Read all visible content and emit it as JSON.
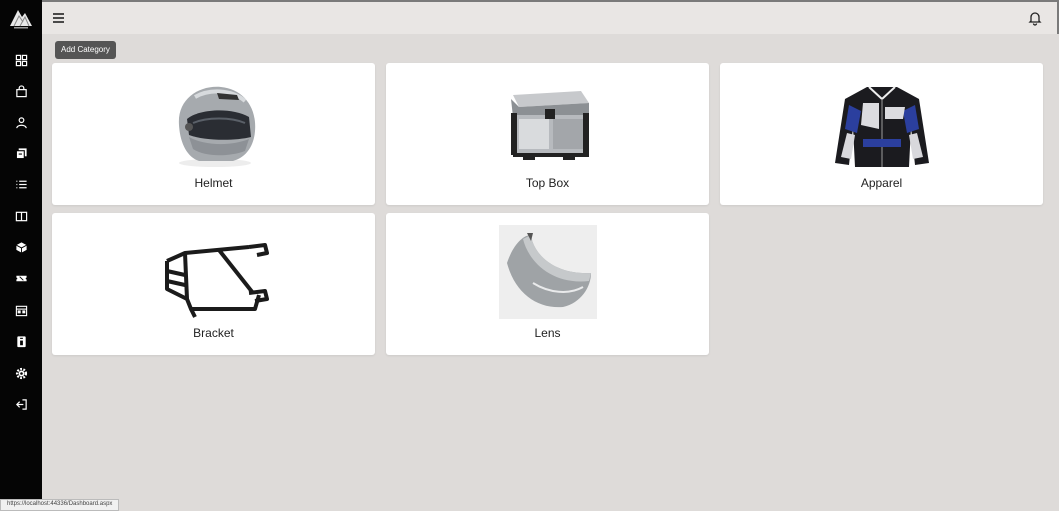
{
  "sidebar": {
    "logo": "mountain-logo-icon",
    "items": [
      {
        "icon": "dashboard-grid-icon"
      },
      {
        "icon": "shopping-bag-icon"
      },
      {
        "icon": "user-icon"
      },
      {
        "icon": "copy-stack-icon"
      },
      {
        "icon": "list-icon"
      },
      {
        "icon": "book-open-icon"
      },
      {
        "icon": "cube-icon"
      },
      {
        "icon": "ticket-icon"
      },
      {
        "icon": "calendar-icon"
      },
      {
        "icon": "id-badge-icon"
      },
      {
        "icon": "settings-icon"
      },
      {
        "icon": "logout-icon"
      }
    ]
  },
  "topbar": {
    "menu_icon": "hamburger-menu-icon",
    "notification_icon": "bell-icon"
  },
  "toolbar": {
    "add_label": "Add Category"
  },
  "categories": [
    {
      "label": "Helmet"
    },
    {
      "label": "Top Box"
    },
    {
      "label": "Apparel"
    },
    {
      "label": "Bracket"
    },
    {
      "label": "Lens"
    }
  ],
  "status_bar": {
    "url": "https://localhost:44336/Dashboard.aspx"
  },
  "colors": {
    "sidebar": "#050505",
    "page_bg": "#dedbd9",
    "topbar": "#e9e6e4",
    "button": "#555555",
    "card": "#ffffff"
  }
}
